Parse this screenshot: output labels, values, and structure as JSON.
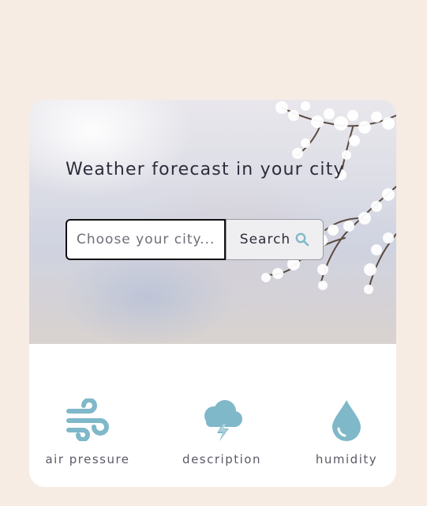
{
  "hero": {
    "title": "Weather forecast in your city"
  },
  "search": {
    "placeholder": "Choose your city......",
    "button_label": "Search",
    "button_icon": "search-icon"
  },
  "stats": [
    {
      "label": "air pressure",
      "icon": "wind-icon"
    },
    {
      "label": "description",
      "icon": "storm-cloud-icon"
    },
    {
      "label": "humidity",
      "icon": "water-drop-icon"
    }
  ],
  "colors": {
    "background": "#f6ece3",
    "card": "#ffffff",
    "icon": "#7fb8c9",
    "text": "#2d2d3c"
  }
}
